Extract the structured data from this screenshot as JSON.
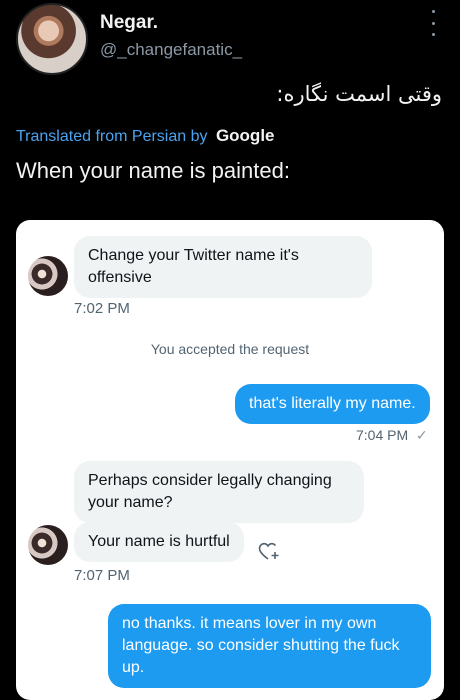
{
  "header": {
    "display_name": "Negar.",
    "handle": "@_changefanatic_",
    "more_icon": "more-vertical-icon"
  },
  "tweet": {
    "original_text": "وقتی اسمت نگاره:",
    "translated_label": "Translated from Persian by",
    "google_label": "Google",
    "translation": "When your name is painted:"
  },
  "dm": {
    "messages": [
      {
        "side": "in",
        "text": "Change your Twitter name it's offensive"
      },
      {
        "side": "in_time",
        "text": "7:02 PM"
      },
      {
        "side": "system",
        "text": "You accepted the request"
      },
      {
        "side": "out",
        "text": "that's literally my name."
      },
      {
        "side": "out_time",
        "text": "7:04 PM"
      },
      {
        "side": "in",
        "text": "Perhaps consider legally changing your name?"
      },
      {
        "side": "in",
        "text": "Your name is hurtful"
      },
      {
        "side": "in_time",
        "text": "7:07 PM"
      },
      {
        "side": "out",
        "text": "no thanks. it means lover in my own language. so consider shutting the fuck up."
      }
    ],
    "colors": {
      "outgoing": "#1d9bf0",
      "incoming": "#eff3f4",
      "link": "#4aa3f0"
    }
  }
}
